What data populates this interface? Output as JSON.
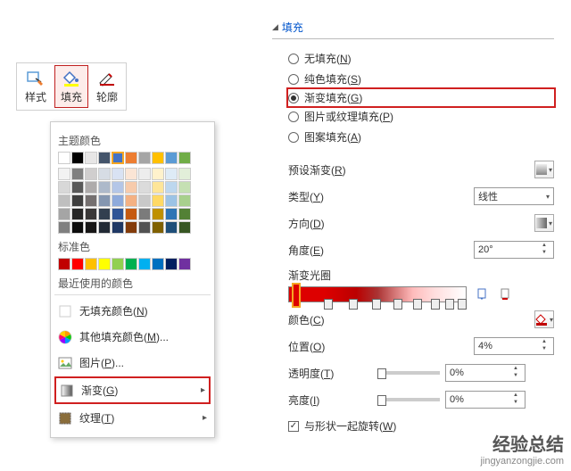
{
  "ribbon": {
    "style_label": "样式",
    "fill_label": "填充",
    "outline_label": "轮廓"
  },
  "color_menu": {
    "theme_title": "主题颜色",
    "theme_row1": [
      "#ffffff",
      "#000000",
      "#e7e6e6",
      "#44546a",
      "#4472c4",
      "#ed7d31",
      "#a5a5a5",
      "#ffc000",
      "#5b9bd5",
      "#70ad47"
    ],
    "theme_tints": [
      [
        "#f2f2f2",
        "#7f7f7f",
        "#d0cece",
        "#d6dce4",
        "#d9e2f3",
        "#fbe5d5",
        "#ededed",
        "#fff2cc",
        "#deebf6",
        "#e2efd9"
      ],
      [
        "#d8d8d8",
        "#595959",
        "#aeabab",
        "#adb9ca",
        "#b4c6e7",
        "#f7cbac",
        "#dbdbdb",
        "#fee599",
        "#bdd7ee",
        "#c5e0b3"
      ],
      [
        "#bfbfbf",
        "#3f3f3f",
        "#757070",
        "#8496b0",
        "#8eaadb",
        "#f4b183",
        "#c9c9c9",
        "#ffd965",
        "#9cc3e5",
        "#a8d08d"
      ],
      [
        "#a5a5a5",
        "#262626",
        "#3a3838",
        "#323f4f",
        "#2f5496",
        "#c55a11",
        "#7b7b7b",
        "#bf9000",
        "#2e75b5",
        "#538135"
      ],
      [
        "#7f7f7f",
        "#0c0c0c",
        "#171616",
        "#222a35",
        "#1f3864",
        "#833c0b",
        "#525252",
        "#7f6000",
        "#1e4e79",
        "#375623"
      ]
    ],
    "standard_title": "标准色",
    "standard_colors": [
      "#c00000",
      "#ff0000",
      "#ffc000",
      "#ffff00",
      "#92d050",
      "#00b050",
      "#00b0f0",
      "#0070c0",
      "#002060",
      "#7030a0"
    ],
    "recent_title": "最近使用的颜色",
    "no_fill_label": "无填充颜色(N)",
    "more_colors_label": "其他填充颜色(M)...",
    "picture_label": "图片(P)...",
    "gradient_label": "渐变(G)",
    "texture_label": "纹理(T)"
  },
  "pane": {
    "header": "填充",
    "options": {
      "none": "无填充(N)",
      "solid": "纯色填充(S)",
      "gradient": "渐变填充(G)",
      "picture": "图片或纹理填充(P)",
      "pattern": "图案填充(A)"
    },
    "preset_label": "预设渐变(R)",
    "type_label": "类型(Y)",
    "type_value": "线性",
    "direction_label": "方向(D)",
    "angle_label": "角度(E)",
    "angle_value": "20°",
    "stops_label": "渐变光圈",
    "color_label": "颜色(C)",
    "position_label": "位置(O)",
    "position_value": "4%",
    "transparency_label": "透明度(T)",
    "transparency_value": "0%",
    "brightness_label": "亮度(I)",
    "brightness_value": "0%",
    "rotate_label": "与形状一起旋转(W)"
  },
  "watermark": {
    "cn": "经验总结",
    "url": "jingyanzongjie.com"
  }
}
